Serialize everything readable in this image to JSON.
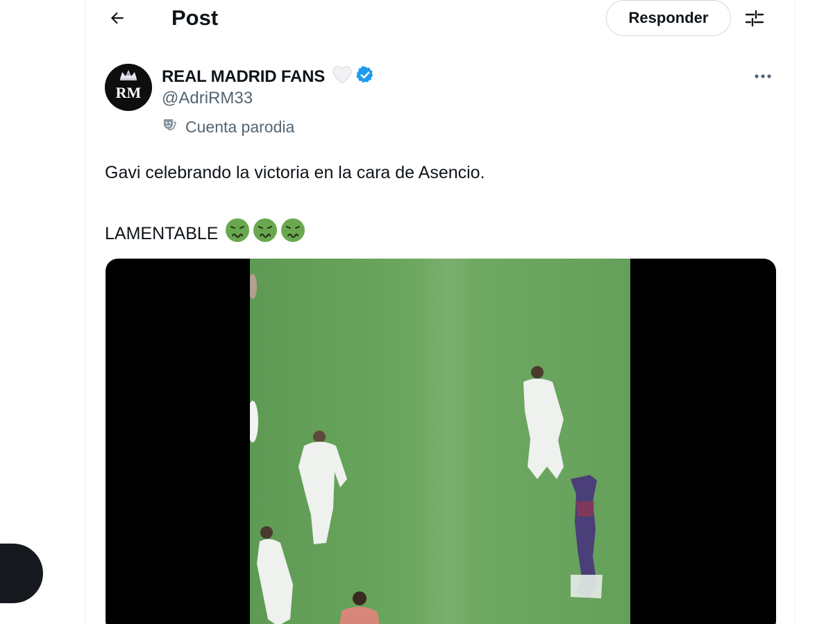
{
  "header": {
    "title": "Post",
    "reply_label": "Responder"
  },
  "post": {
    "author_name": "REAL MADRID FANS",
    "handle": "@AdriRM33",
    "account_label": "Cuenta parodia",
    "avatar_initials": "RM",
    "text_line1": "Gavi celebrando la victoria en la cara de Asencio.",
    "text_line2": "LAMENTABLE",
    "emojis": [
      "nauseated-face-icon",
      "nauseated-face-icon",
      "nauseated-face-icon"
    ]
  },
  "icons": {
    "back": "arrow-left-icon",
    "settings": "sliders-icon",
    "heart": "white-heart-icon",
    "verified": "verified-badge-icon",
    "more": "more-dots-icon",
    "parody": "theater-mask-icon"
  },
  "colors": {
    "verified": "#1d9bf0",
    "secondary_text": "#536471",
    "emoji_green": "#6aa84f"
  }
}
